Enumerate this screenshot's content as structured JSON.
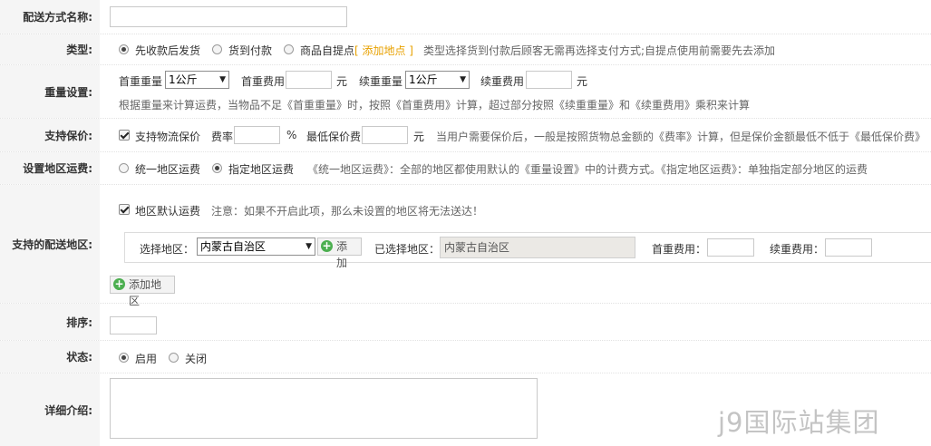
{
  "labels": {
    "name": "配送方式名称:",
    "type": "类型:",
    "weight": "重量设置:",
    "insurance": "支持保价:",
    "region_fee": "设置地区运费:",
    "regions": "支持的配送地区:",
    "sort": "排序:",
    "status": "状态:",
    "description": "详细介绍:"
  },
  "name_value": "",
  "type_options": [
    {
      "label": "先收款后发货",
      "selected": true
    },
    {
      "label": "货到付款",
      "selected": false
    },
    {
      "label": "商品自提点",
      "selected": false
    }
  ],
  "type_add_pickup": "[ 添加地点 ]",
  "type_hint": "类型选择货到付款后顾客无需再选择支付方式;自提点使用前需要先去添加",
  "weight": {
    "first_weight_label": "首重重量",
    "first_weight_value": "1公斤",
    "first_fee_label": "首重费用",
    "first_fee_value": "",
    "unit_yuan": "元",
    "cont_weight_label": "续重重量",
    "cont_weight_value": "1公斤",
    "cont_fee_label": "续重费用",
    "cont_fee_value": "",
    "hint": "根据重量来计算运费，当物品不足《首重重量》时，按照《首重费用》计算，超过部分按照《续重重量》和《续重费用》乘积来计算"
  },
  "insurance": {
    "checkbox_label": "支持物流保价",
    "checked": true,
    "rate_label": "费率",
    "rate_value": "",
    "percent": "%",
    "min_label": "最低保价费",
    "min_value": "",
    "unit_yuan": "元",
    "hint": "当用户需要保价后，一般是按照货物总金额的《费率》计算，但是保价金额最低不低于《最低保价费》"
  },
  "region_fee": {
    "options": [
      {
        "label": "统一地区运费",
        "selected": false
      },
      {
        "label": "指定地区运费",
        "selected": true
      }
    ],
    "hint": "《统一地区运费》：全部的地区都使用默认的《重量设置》中的计费方式。《指定地区运费》：单独指定部分地区的运费"
  },
  "regions": {
    "default_label": "地区默认运费",
    "default_checked": true,
    "default_hint": "注意：如果不开启此项，那么未设置的地区将无法送达！",
    "select_label": "选择地区：",
    "select_value": "内蒙古自治区",
    "add_button": "添加",
    "selected_label": "已选择地区：",
    "selected_value": "内蒙古自治区",
    "first_fee_label": "首重费用：",
    "first_fee_value": "",
    "cont_fee_label": "续重费用：",
    "cont_fee_value": "",
    "add_region_button": "添加地区"
  },
  "sort_value": "",
  "status_options": [
    {
      "label": "启用",
      "selected": true
    },
    {
      "label": "关闭",
      "selected": false
    }
  ],
  "description_value": "",
  "watermark": "j9国际站集团",
  "colors": {
    "label_bg": "#f5f5f5",
    "link": "#e8a100",
    "add_icon": "#4caf50"
  }
}
